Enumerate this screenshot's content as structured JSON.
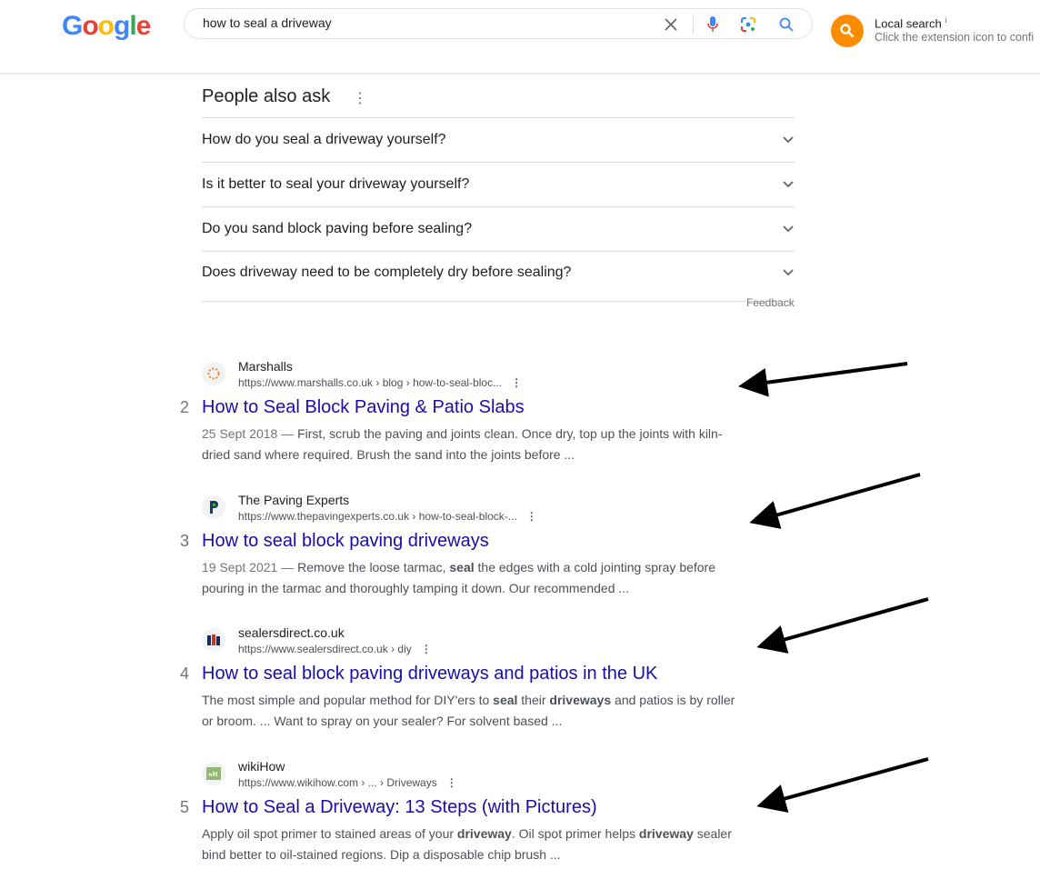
{
  "header": {
    "logo": "Google",
    "query": "how to seal a driveway",
    "extension": {
      "title": "Local search",
      "info": "i",
      "subtitle": "Click the extension icon to confi"
    }
  },
  "paa": {
    "title": "People also ask",
    "questions": [
      "How do you seal a driveway yourself?",
      "Is it better to seal your driveway yourself?",
      "Do you sand block paving before sealing?",
      "Does driveway need to be completely dry before sealing?"
    ],
    "feedback": "Feedback"
  },
  "results": [
    {
      "rank": "2",
      "site": "Marshalls",
      "url": "https://www.marshalls.co.uk › blog › how-to-seal-bloc...",
      "title": "How to Seal Block Paving & Patio Slabs",
      "date": "25 Sept 2018 — ",
      "snippet": "First, scrub the paving and joints clean. Once dry, top up the joints with kiln-dried sand where required. Brush the sand into the joints before ..."
    },
    {
      "rank": "3",
      "site": "The Paving Experts",
      "url": "https://www.thepavingexperts.co.uk › how-to-seal-block-...",
      "title": "How to seal block paving driveways",
      "date": "19 Sept 2021 — ",
      "snippet": "Remove the loose tarmac, <b>seal</b> the edges with a cold jointing spray before pouring in the tarmac and thoroughly tamping it down. Our recommended ..."
    },
    {
      "rank": "4",
      "site": "sealersdirect.co.uk",
      "url": "https://www.sealersdirect.co.uk › diy",
      "title": "How to seal block paving driveways and patios in the UK",
      "date": "",
      "snippet": "The most simple and popular method for DIY'ers to <b>seal</b> their <b>driveways</b> and patios is by roller or broom. ... Want to spray on your sealer? For solvent based ..."
    },
    {
      "rank": "5",
      "site": "wikiHow",
      "url": "https://www.wikihow.com › ... › Driveways",
      "title": "How to Seal a Driveway: 13 Steps (with Pictures)",
      "date": "",
      "snippet": "Apply oil spot primer to stained areas of your <b>driveway</b>. Oil spot primer helps <b>driveway</b> sealer bind better to oil-stained regions. Dip a disposable chip brush ..."
    }
  ],
  "colors": {
    "link": "#1a0dab",
    "extension": "#fb8c00"
  }
}
